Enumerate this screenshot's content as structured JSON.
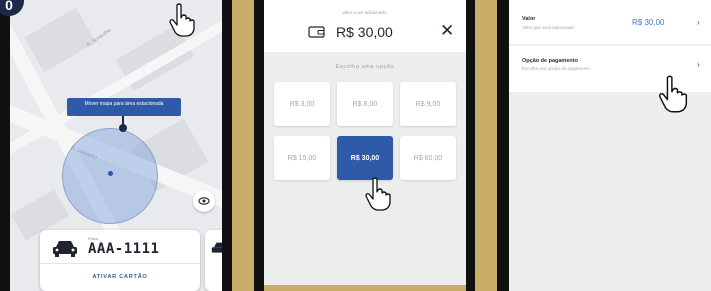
{
  "map_screen": {
    "logo_letter": "0",
    "tooltip_text": "Mover mapa para área estacionada",
    "street_labels": [
      "R. Sorocaba",
      "R. Camacho"
    ],
    "card": {
      "plate_label": "Placa",
      "plate": "AAA-1111",
      "activate_label": "ATIVAR CARTÃO"
    }
  },
  "value_screen": {
    "subtitle": "Valor a ser adicionado",
    "current_value": "R$ 30,00",
    "close_label": "✕",
    "prompt": "Escolha uma opção",
    "options": [
      "R$ 3,00",
      "R$ 6,00",
      "R$ 9,00",
      "R$ 15,00",
      "R$ 30,00",
      "R$ 60,00"
    ],
    "selected_option": "R$ 30,00"
  },
  "payment_screen": {
    "value_row": {
      "title": "Valor",
      "subtitle": "Valor que será adicionado",
      "value": "R$ 30,00",
      "chevron": "›"
    },
    "payment_row": {
      "title": "Opção de pagamento",
      "subtitle": "Escolha sua opção de pagamento",
      "chevron": "›"
    }
  },
  "colors": {
    "accent": "#2e5aa8",
    "gold_backdrop": "#c9ae6a",
    "value_blue": "#4b78c8"
  }
}
